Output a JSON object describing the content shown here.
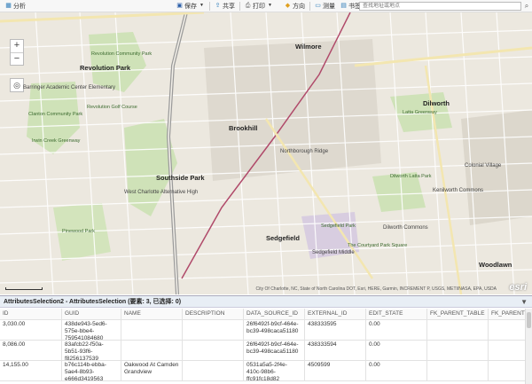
{
  "toolbar": {
    "analysis_label": "分析",
    "save_label": "保存",
    "share_label": "共享",
    "print_label": "打印",
    "directions_label": "方向",
    "measure_label": "测量",
    "bookmarks_label": "书签",
    "search_placeholder": "查找地址或地点"
  },
  "map": {
    "labels": [
      "Revolution Park",
      "Revolution Golf Course",
      "Revolution Community Park",
      "Barringer Academic Center Elementary",
      "Clanton Community Park",
      "Irwin Creek Greenway",
      "Wilmore",
      "Dilworth",
      "Latta Greenway",
      "Brookhill",
      "Southside Park",
      "West Charlotte Alternative High",
      "Dilworth Latta Park",
      "Kenilworth Commons",
      "Sedgefield Middle",
      "Sedgefield Park",
      "Dilworth Commons",
      "Pinewood Park",
      "Colonial Village",
      "The Courtyard Park Square",
      "Sedgefield",
      "Northborough Ridge",
      "Woodlawn"
    ],
    "attribution": "City Of Charlotte, NC, State of North Carolina DOT, Esri, HERE, Garmin, INCREMENT P, USGS, METI/NASA, EPA, USDA",
    "esri_logo": "esri"
  },
  "panel": {
    "title": "AttributesSelection2 - AttributesSelection (要素: 3, 已选择: 0)"
  },
  "table": {
    "columns": [
      "ID",
      "GUID",
      "NAME",
      "DESCRIPTION",
      "DATA_SOURCE_ID",
      "EXTERNAL_ID",
      "EDIT_STATE",
      "FK_PARENT_TABLE",
      "FK_PARENT"
    ],
    "rows": [
      [
        "3,030.00",
        "438de943-5ed6-575e-bbe4-759541084680",
        "",
        "",
        "26f6492f-b9cf-464e-bc39-498caca51180",
        "438333595",
        "0.00",
        "",
        ""
      ],
      [
        "8,086.00",
        "83afcb22-f50a-5b51-93f6-f8256137539",
        "",
        "",
        "26f6492f-b9cf-464e-bc39-498caca51180",
        "438333594",
        "0.00",
        "",
        ""
      ],
      [
        "14,155.00",
        "b76c114b-ebba-5ae4-8b93-e666d3419563",
        "Oakwood At Camden Grandview",
        "",
        "0531a5a5-2f4e-410c-98b6-ffc91fc18d82",
        "4509599",
        "0.00",
        "",
        ""
      ]
    ]
  }
}
